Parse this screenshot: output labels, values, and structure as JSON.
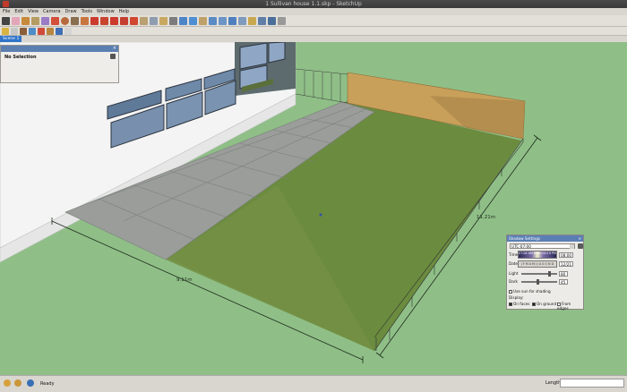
{
  "window": {
    "title": "1 Sullivan house 1.1.skp - SketchUp"
  },
  "menu": [
    "File",
    "Edit",
    "View",
    "Camera",
    "Draw",
    "Tools",
    "Window",
    "Help"
  ],
  "scene_tab": "Scene 1",
  "entity_info": {
    "selection": "No Selection"
  },
  "dimensions": {
    "width": "9.11m",
    "length": "11.21m"
  },
  "shadow_settings": {
    "title": "Shadow Settings",
    "timezone": "UTC-07:00",
    "time_label": "Time",
    "date_label": "Date",
    "time_ticks": "07:04 AM  Noon  04:19 PM",
    "time_value": "08:00",
    "date_ticks": "J F M A M J J A S O N D",
    "date_value": "12/21",
    "light_label": "Light",
    "dark_label": "Dark",
    "light_value": "80",
    "dark_value": "45",
    "light_level": 0.8,
    "dark_level": 0.45,
    "sun_label": "Use sun for shading",
    "display_label": "Display:",
    "on_faces": "On faces",
    "on_ground": "On ground",
    "from_edges": "From edges",
    "on_faces_checked": true,
    "on_ground_checked": true,
    "from_edges_checked": false
  },
  "status": {
    "text": "Ready",
    "length_label": "Length"
  },
  "colors": {
    "sky": "#8fbf87",
    "lawn": "#6a8a3c",
    "concrete": "#9b9e9b",
    "brick": "#c9a05a",
    "accent": "#2f74c8"
  },
  "toolbar_icons": [
    "select-icon",
    "eraser-icon",
    "paint-icon",
    "component-icon",
    "line-icon",
    "pencil-icon",
    "circle-icon",
    "arc-icon",
    "rectangle-icon",
    "push-pull-icon",
    "move-icon",
    "rotate-icon",
    "offset-icon",
    "follow-me-icon",
    "tape-icon",
    "dimension-icon",
    "protractor-icon",
    "text-icon",
    "axes-icon",
    "orbit-icon",
    "pan-icon",
    "zoom-icon",
    "zoom-window-icon",
    "zoom-extents-icon",
    "walk-icon",
    "look-icon",
    "position-camera-icon",
    "section-icon",
    "xray-icon"
  ]
}
